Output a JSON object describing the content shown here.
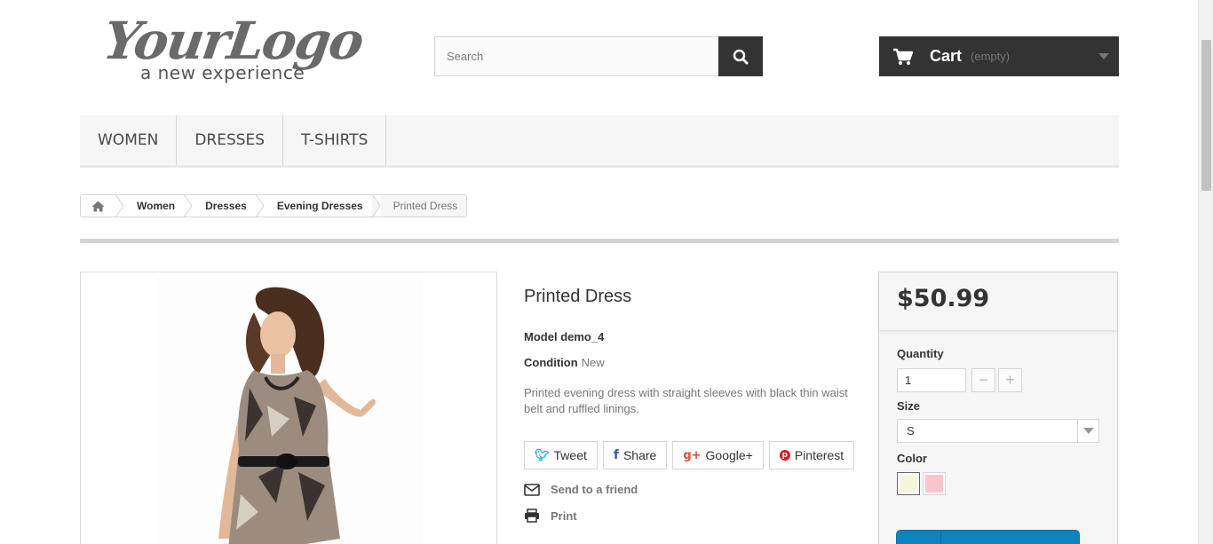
{
  "logo": {
    "main": "YourLogo",
    "tagline": "a new experience"
  },
  "search": {
    "placeholder": "Search",
    "value": "",
    "icon": "search-icon"
  },
  "cart": {
    "title": "Cart",
    "status": "(empty)",
    "icon": "shopping-cart-icon"
  },
  "menu": {
    "items": [
      {
        "label": "WOMEN"
      },
      {
        "label": "DRESSES"
      },
      {
        "label": "T-SHIRTS"
      }
    ]
  },
  "breadcrumb": {
    "home_icon": "home-icon",
    "items": [
      {
        "label": "Women"
      },
      {
        "label": "Dresses"
      },
      {
        "label": "Evening Dresses"
      }
    ],
    "current": "Printed Dress"
  },
  "product": {
    "name": "Printed Dress",
    "model_label": "Model",
    "model": "demo_4",
    "condition_label": "Condition",
    "condition": "New",
    "description": "Printed evening dress with straight sleeves with black thin waist belt and ruffled linings.",
    "image_alt": "Woman wearing printed dress"
  },
  "social": {
    "tweet": "Tweet",
    "share": "Share",
    "google": "Google+",
    "pinterest": "Pinterest"
  },
  "links": {
    "send": "Send to a friend",
    "print": "Print"
  },
  "buy": {
    "price": "$50.99",
    "quantity_label": "Quantity",
    "quantity": "1",
    "size_label": "Size",
    "size_selected": "S",
    "color_label": "Color",
    "colors": [
      "#f5f5dc",
      "#fcc4cc"
    ]
  },
  "colors": {
    "accent": "#0d83c2",
    "dark": "#333333",
    "panel": "#f6f6f6"
  }
}
